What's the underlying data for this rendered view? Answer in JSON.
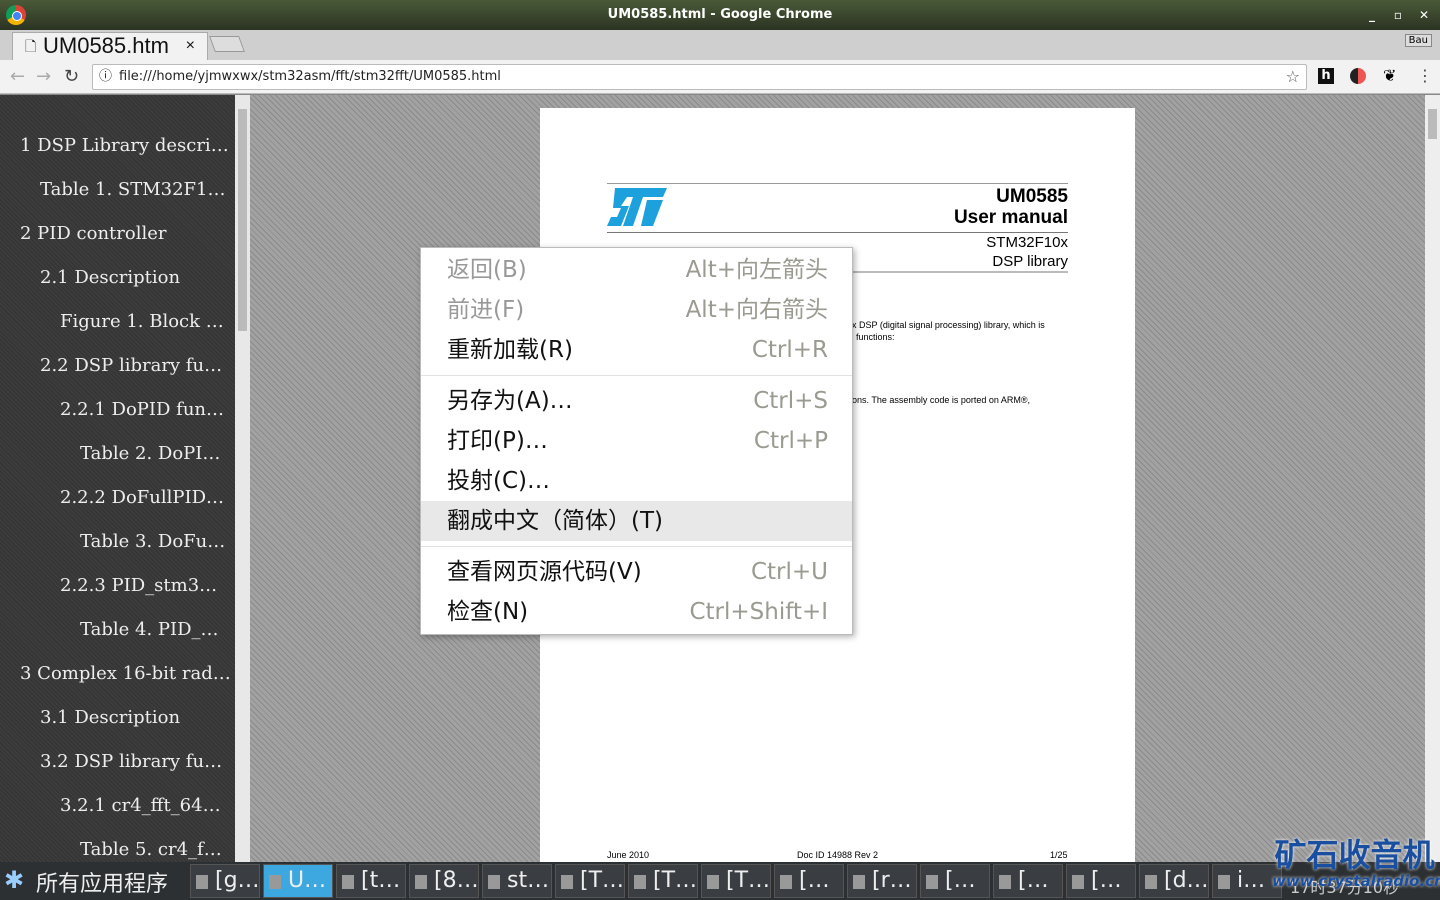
{
  "window": {
    "title": "UM0585.html - Google Chrome",
    "min": "_",
    "max": "▫",
    "close": "✕"
  },
  "tab": {
    "title": "UM0585.htm",
    "close": "×"
  },
  "toolbar": {
    "url": "file:///home/yjmwxwx/stm32asm/fft/stm32fft/UM0585.html",
    "ext_label": "Bau"
  },
  "sidebar": {
    "items": [
      {
        "label": "1 DSP Library descri…",
        "level": 0
      },
      {
        "label": "Table 1. STM32F1…",
        "level": 1
      },
      {
        "label": "2 PID controller",
        "level": 0
      },
      {
        "label": "2.1 Description",
        "level": 1
      },
      {
        "label": "Figure 1. Block …",
        "level": 2
      },
      {
        "label": "2.2 DSP library fu…",
        "level": 1
      },
      {
        "label": "2.2.1 DoPID fun…",
        "level": 2
      },
      {
        "label": "Table 2. DoPI…",
        "level": 3
      },
      {
        "label": "2.2.2 DoFullPID…",
        "level": 2
      },
      {
        "label": "Table 3. DoFu…",
        "level": 3
      },
      {
        "label": "2.2.3 PID_stm3…",
        "level": 2
      },
      {
        "label": "Table 4. PID_…",
        "level": 3
      },
      {
        "label": "3 Complex 16-bit rad…",
        "level": 0
      },
      {
        "label": "3.1 Description",
        "level": 1
      },
      {
        "label": "3.2 DSP library fu…",
        "level": 1
      },
      {
        "label": "3.2.1 cr4_fft_64…",
        "level": 2
      },
      {
        "label": "Table 5. cr4_f…",
        "level": 3
      }
    ]
  },
  "document": {
    "logo": "ST",
    "doc_number": "UM0585",
    "doc_type": "User manual",
    "product": "STM32F10x",
    "subtitle": "DSP library",
    "text1": "x DSP (digital signal processing) library, which is",
    "text2": "functions:",
    "text3": "ons. The assembly code is ported on ARM®,",
    "footer_date": "June 2010",
    "footer_doc": "Doc ID 14988 Rev 2",
    "footer_page": "1/25"
  },
  "context_menu": {
    "items": [
      {
        "label": "返回(B)",
        "shortcut": "Alt+向左箭头",
        "disabled": true
      },
      {
        "label": "前进(F)",
        "shortcut": "Alt+向右箭头",
        "disabled": true
      },
      {
        "label": "重新加载(R)",
        "shortcut": "Ctrl+R"
      },
      {
        "label": "另存为(A)…",
        "shortcut": "Ctrl+S"
      },
      {
        "label": "打印(P)…",
        "shortcut": "Ctrl+P"
      },
      {
        "label": "投射(C)…",
        "shortcut": ""
      },
      {
        "label": "翻成中文（简体）(T)",
        "shortcut": "",
        "highlighted": true
      },
      {
        "label": "查看网页源代码(V)",
        "shortcut": "Ctrl+U"
      },
      {
        "label": "检查(N)",
        "shortcut": "Ctrl+Shift+I"
      }
    ]
  },
  "taskbar": {
    "start": "所有应用程序",
    "items": [
      "[g…",
      "U…",
      "[t…",
      "[8…",
      "st…",
      "[T…",
      "[T…",
      "[T…",
      "[…",
      "[r…",
      "[…",
      "[…",
      "[…",
      "[d…",
      "i…"
    ],
    "clock": "17时37分10秒",
    "watermark": "矿石收音机",
    "watermark_url": "www.crystalradio.cn"
  }
}
